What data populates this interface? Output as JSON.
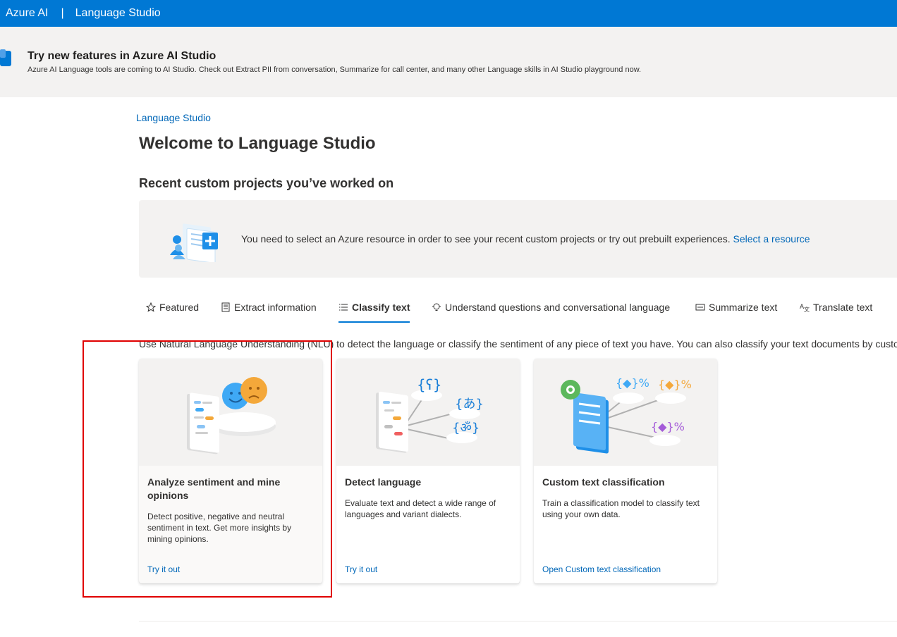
{
  "topbar": {
    "brand": "Azure AI",
    "separator": "|",
    "product": "Language Studio"
  },
  "banner": {
    "title": "Try new features in Azure AI Studio",
    "text": "Azure AI Language tools are coming to AI Studio. Check out Extract PII from conversation, Summarize for call center, and many other Language skills in AI Studio playground now."
  },
  "breadcrumb": "Language Studio",
  "page_title": "Welcome to Language Studio",
  "recent": {
    "heading": "Recent custom projects you’ve worked on",
    "notice_text": "You need to select an Azure resource in order to see your recent custom projects or try out prebuilt experiences.",
    "notice_link": "Select a resource"
  },
  "tabs": [
    {
      "label": "Featured",
      "icon": "star-icon"
    },
    {
      "label": "Extract information",
      "icon": "document-icon"
    },
    {
      "label": "Classify text",
      "icon": "list-icon",
      "active": true
    },
    {
      "label": "Understand questions and conversational language",
      "icon": "chat-bulb-icon"
    },
    {
      "label": "Summarize text",
      "icon": "summary-icon"
    },
    {
      "label": "Translate text",
      "icon": "translate-icon"
    }
  ],
  "tab_description": "Use Natural Language Understanding (NLU) to detect the language or classify the sentiment of any piece of text you have. You can also classify your text documents by custom",
  "cards": [
    {
      "title": "Analyze sentiment and mine opinions",
      "description": "Detect positive, negative and neutral sentiment in text. Get more insights by mining opinions.",
      "link": "Try it out"
    },
    {
      "title": "Detect language",
      "description": "Evaluate text and detect a wide range of languages and variant dialects.",
      "link": "Try it out"
    },
    {
      "title": "Custom text classification",
      "description": "Train a classification model to classify text using your own data.",
      "link": "Open Custom text classification"
    }
  ],
  "colors": {
    "accent": "#0078d4",
    "link": "#0067b8",
    "highlight_box": "#e00000"
  }
}
